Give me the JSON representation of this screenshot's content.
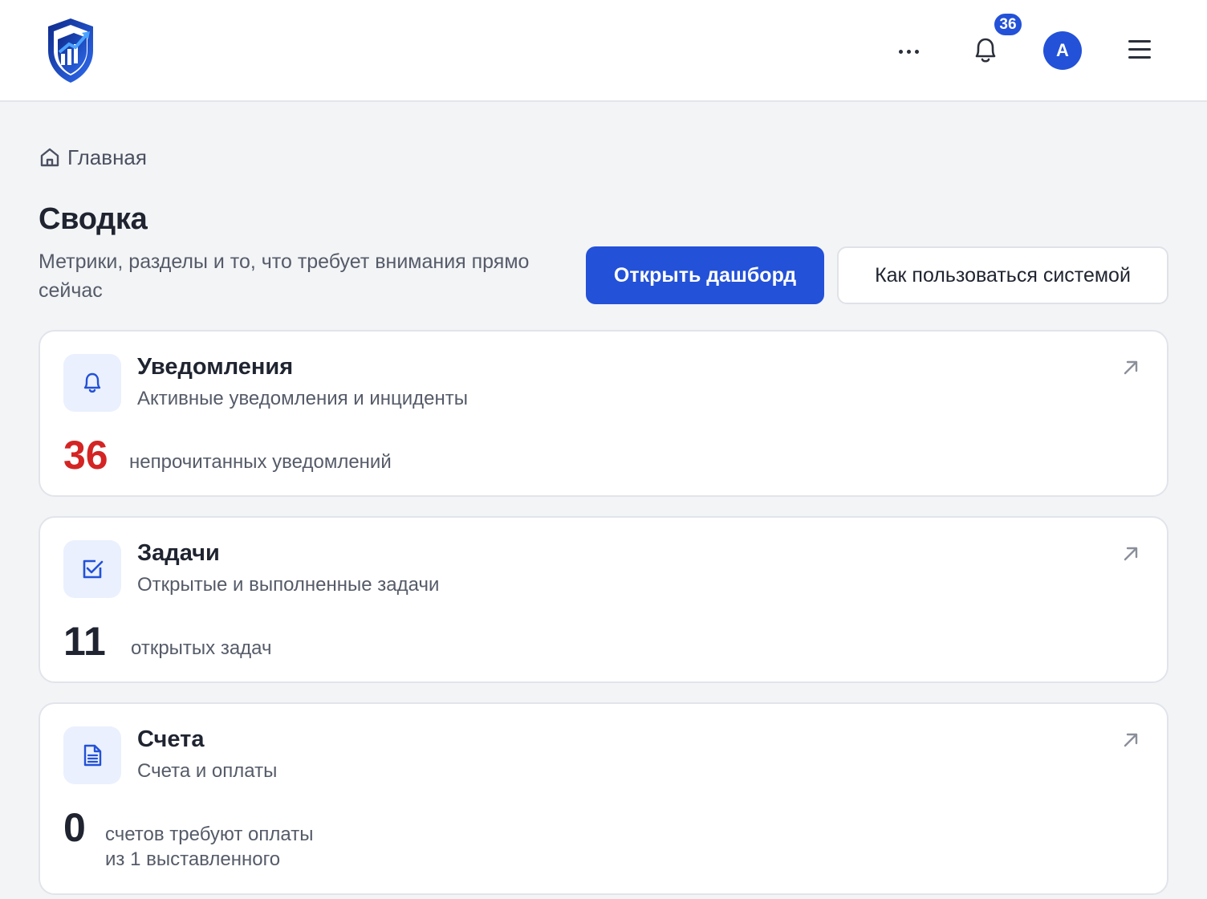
{
  "header": {
    "logo_icon": "shield-chart-logo",
    "notifications_count": "36",
    "avatar_letter": "A"
  },
  "breadcrumb": {
    "icon": "home-icon",
    "label": "Главная"
  },
  "page": {
    "title": "Сводка",
    "subtitle": "Метрики, разделы и то, что требует внимания прямо сейчас",
    "primary_button": "Открыть дашборд",
    "secondary_button": "Как пользоваться системой"
  },
  "cards": [
    {
      "icon": "bell-icon",
      "title": "Уведомления",
      "description": "Активные уведомления и инциденты",
      "value": "36",
      "unit_line1": "непрочитанных уведомлений",
      "value_color": "#d42424"
    },
    {
      "icon": "checkbox-icon",
      "title": "Задачи",
      "description": "Открытые и выполненные задачи",
      "value": "11",
      "unit_line1": "открытых задач",
      "value_color": "#1f2430"
    },
    {
      "icon": "document-icon",
      "title": "Счета",
      "description": "Счета и оплаты",
      "value": "0",
      "unit_line1": "счетов требуют оплаты",
      "unit_line2": "из 1 выставленного",
      "value_color": "#1f2430"
    }
  ],
  "colors": {
    "accent": "#2351d8",
    "danger": "#d42424",
    "background": "#f3f4f6"
  }
}
